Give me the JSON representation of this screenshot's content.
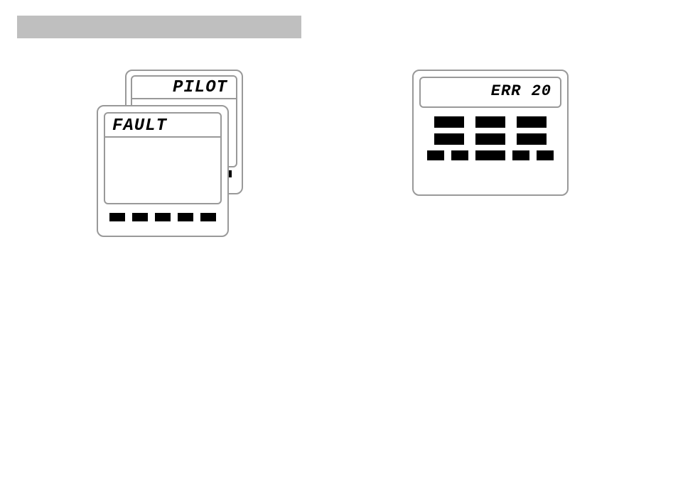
{
  "deviceA": {
    "display": "PILOT"
  },
  "deviceB": {
    "display": "FAULT"
  },
  "deviceC": {
    "display": "ERR 20"
  }
}
